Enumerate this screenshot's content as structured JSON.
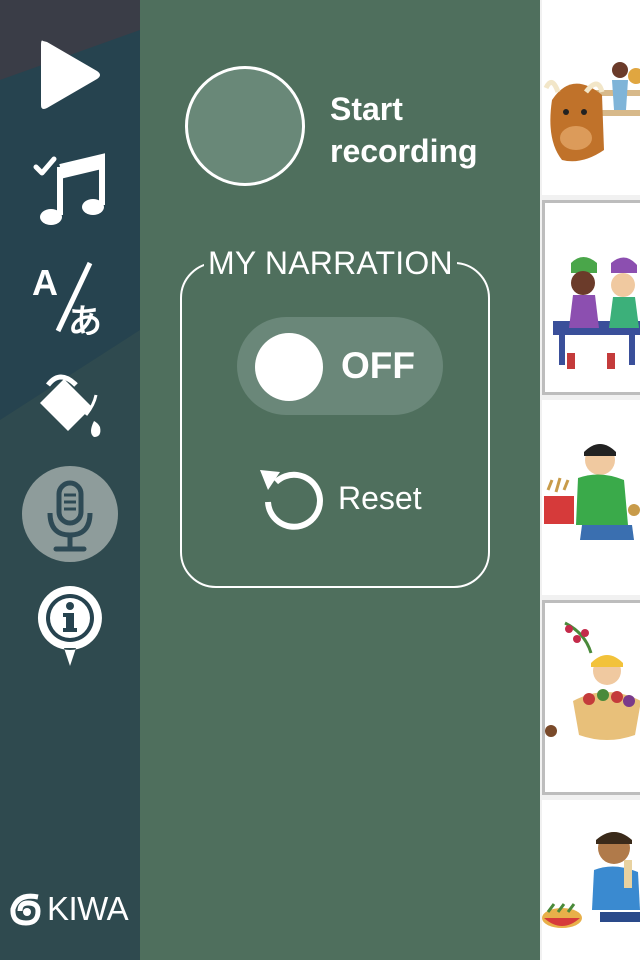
{
  "sidebar": {
    "items": [
      {
        "name": "play-icon",
        "active": false
      },
      {
        "name": "music-check-icon",
        "active": false
      },
      {
        "name": "translate-icon",
        "active": false
      },
      {
        "name": "paint-bucket-icon",
        "active": false
      },
      {
        "name": "microphone-icon",
        "active": true
      },
      {
        "name": "info-icon",
        "active": false
      }
    ],
    "logo_text": "KIWA"
  },
  "recording": {
    "label": "Start recording"
  },
  "narration": {
    "title": "MY NARRATION",
    "toggle_state": "OFF",
    "reset_label": "Reset"
  },
  "pages": [
    {
      "name": "page-thumbnail-1",
      "selected": false
    },
    {
      "name": "page-thumbnail-2",
      "selected": true
    },
    {
      "name": "page-thumbnail-3",
      "selected": false
    },
    {
      "name": "page-thumbnail-4",
      "selected": false
    },
    {
      "name": "page-thumbnail-5",
      "selected": false
    }
  ],
  "colors": {
    "panel": "#4f6f5d",
    "sidebar": "#213f4b",
    "sidebar_light": "#2f4a4f",
    "sidebar_highlight": "#8e9c9b",
    "toggle_track": "#6a8779"
  }
}
